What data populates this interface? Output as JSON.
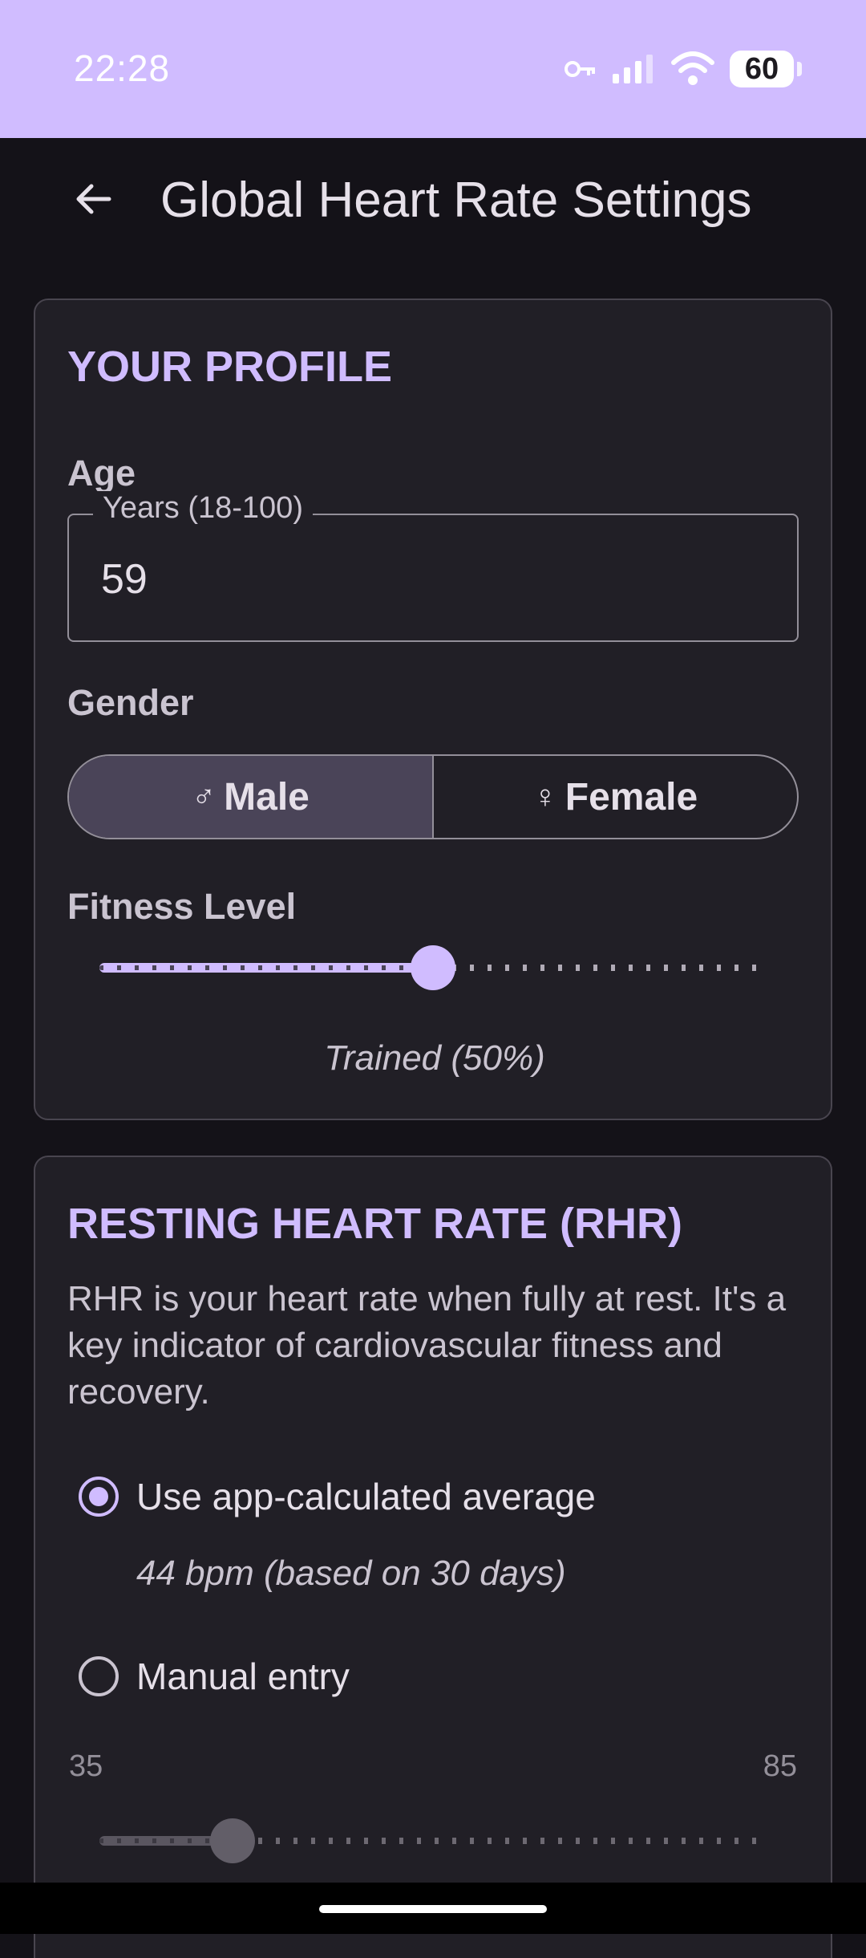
{
  "status_bar": {
    "time": "22:28",
    "battery": "60",
    "icons": [
      "vpn-key-icon",
      "signal-icon",
      "wifi-icon",
      "battery-icon"
    ]
  },
  "app_bar": {
    "back_icon": "arrow-left-icon",
    "title": "Global Heart Rate Settings"
  },
  "profile": {
    "title": "YOUR PROFILE",
    "age": {
      "label": "Age",
      "field_label": "Years (18-100)",
      "value": "59"
    },
    "gender": {
      "label": "Gender",
      "options": [
        {
          "symbol": "♂",
          "label": "Male",
          "selected": true
        },
        {
          "symbol": "♀",
          "label": "Female",
          "selected": false
        }
      ]
    },
    "fitness": {
      "label": "Fitness Level",
      "value_percent": 50,
      "caption": "Trained (50%)"
    }
  },
  "rhr": {
    "title": "RESTING HEART RATE (RHR)",
    "description": "RHR is your heart rate when fully at rest. It's a key indicator of cardiovascular fitness and recovery.",
    "options": [
      {
        "label": "Use app-calculated average",
        "checked": true
      },
      {
        "label": "Manual entry",
        "checked": false
      }
    ],
    "calculated_value": "44 bpm (based on 30 days)",
    "manual": {
      "min_label": "35",
      "max_label": "85",
      "min": 35,
      "max": 85,
      "value": 45
    }
  },
  "colors": {
    "accent": "#d0bcff",
    "background": "#141218",
    "card": "#211f26",
    "outline": "#938f99"
  }
}
